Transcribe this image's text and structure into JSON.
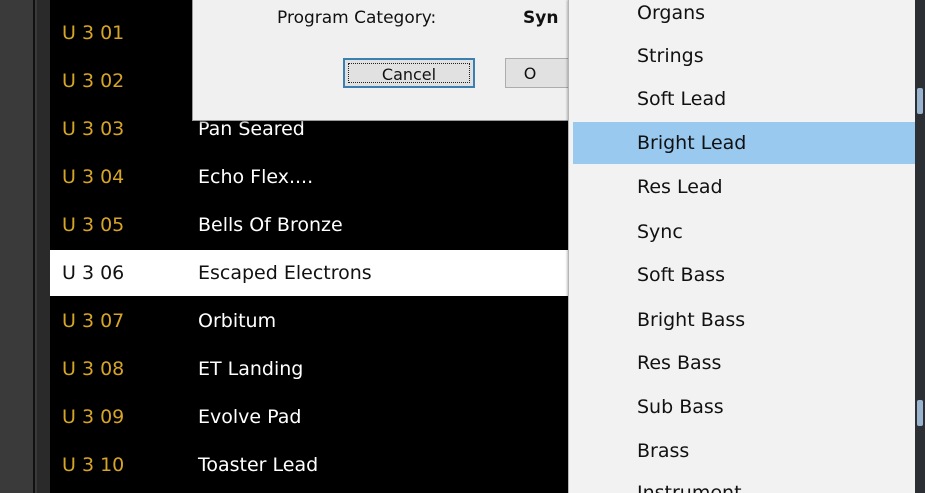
{
  "program_list": {
    "rows": [
      {
        "number": "U 3 01",
        "name": ""
      },
      {
        "number": "U 3 02",
        "name": ""
      },
      {
        "number": "U 3 03",
        "name": "Pan Seared"
      },
      {
        "number": "U 3 04",
        "name": "Echo Flex...."
      },
      {
        "number": "U 3 05",
        "name": "Bells Of Bronze"
      },
      {
        "number": "U 3 06",
        "name": "Escaped Electrons"
      },
      {
        "number": "U 3 07",
        "name": "Orbitum"
      },
      {
        "number": "U 3 08",
        "name": "ET Landing"
      },
      {
        "number": "U 3 09",
        "name": "Evolve Pad"
      },
      {
        "number": "U 3 10",
        "name": "Toaster Lead"
      }
    ],
    "selected_index": 5,
    "number_color": "#d6a526"
  },
  "dialog": {
    "category_label": "Program Category:",
    "category_value": "Syn",
    "cancel_label": "Cancel",
    "ok_label": "O"
  },
  "category_menu": {
    "items": [
      "Organs",
      "Strings",
      "Soft Lead",
      "Bright Lead",
      "Res Lead",
      "Sync",
      "Soft Bass",
      "Bright Bass",
      "Res Bass",
      "Sub Bass",
      "Brass",
      "Instrument"
    ],
    "highlighted_index": 3,
    "highlight_color": "#99c9ef"
  }
}
